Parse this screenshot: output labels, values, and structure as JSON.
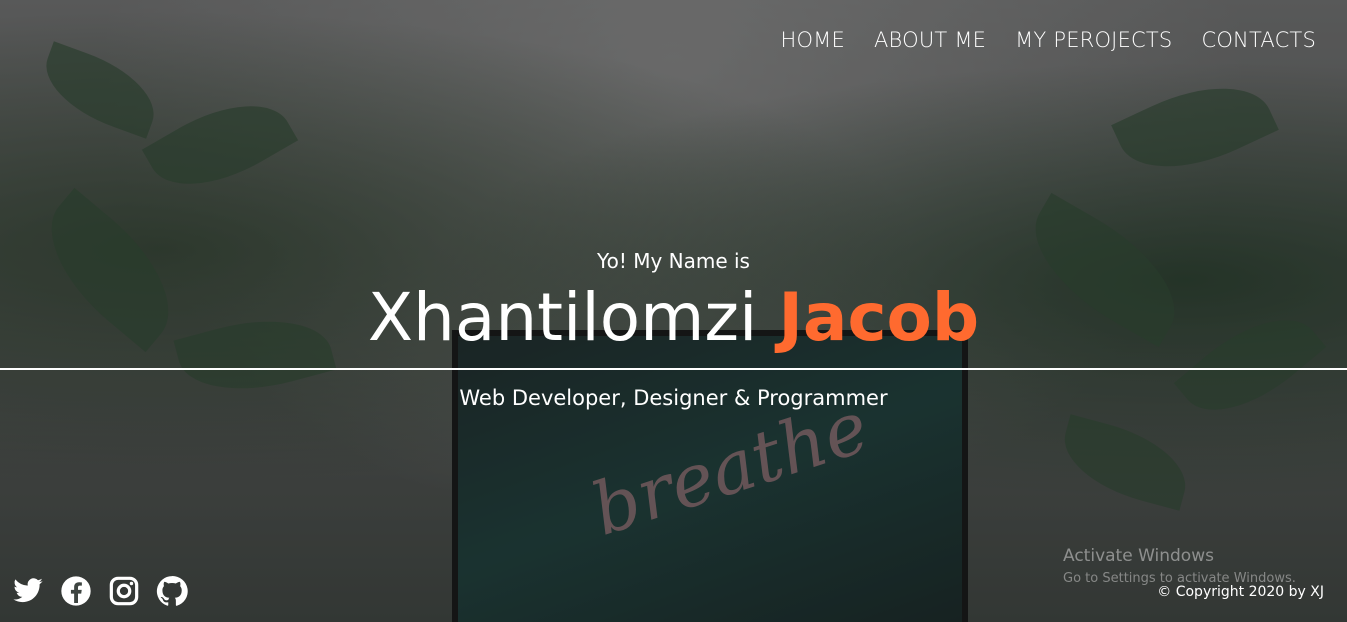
{
  "nav": {
    "items": [
      {
        "label": "HOME"
      },
      {
        "label": "ABOUT ME"
      },
      {
        "label": "MY PEROJECTS"
      },
      {
        "label": "CONTACTS"
      }
    ]
  },
  "hero": {
    "greeting": "Yo! My Name is",
    "first_name": "Xhantilomzi",
    "last_name": "Jacob",
    "subtitle": "Web Developer, Designer & Programmer",
    "accent_color": "#ff6a2f"
  },
  "background": {
    "neon_text": "breathe"
  },
  "socials": [
    {
      "icon": "twitter-icon"
    },
    {
      "icon": "facebook-icon"
    },
    {
      "icon": "instagram-icon"
    },
    {
      "icon": "github-icon"
    }
  ],
  "watermark": {
    "title": "Activate Windows",
    "subtitle": "Go to Settings to activate Windows."
  },
  "footer": {
    "copyright": "© Copyright 2020 by XJ"
  }
}
